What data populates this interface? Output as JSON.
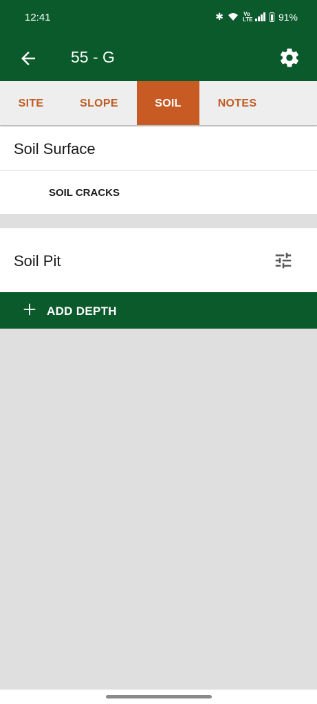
{
  "status": {
    "time": "12:41",
    "volte": "Vo\nLTE",
    "battery": "91%"
  },
  "appbar": {
    "title": "55 - G",
    "back_icon": "arrow-left-icon",
    "settings_icon": "gear-icon"
  },
  "tabs": [
    {
      "label": "SITE",
      "active": false
    },
    {
      "label": "SLOPE",
      "active": false
    },
    {
      "label": "SOIL",
      "active": true
    },
    {
      "label": "NOTES",
      "active": false
    }
  ],
  "soil_surface": {
    "title": "Soil Surface",
    "cracks_button": "SOIL CRACKS"
  },
  "soil_pit": {
    "title": "Soil Pit",
    "filter_icon": "tune-icon",
    "add_depth_label": "ADD DEPTH"
  },
  "colors": {
    "primary": "#0a5a2c",
    "accent": "#c85a24",
    "background": "#dfdfdf"
  }
}
